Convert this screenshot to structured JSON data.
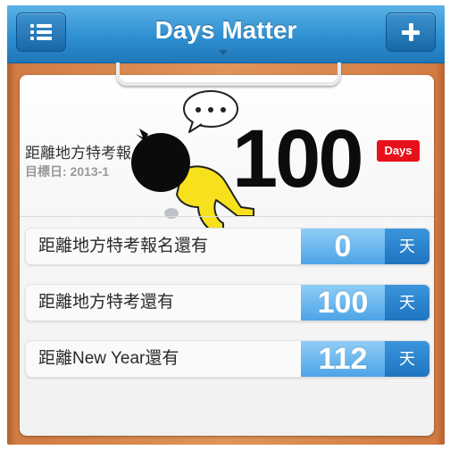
{
  "navbar": {
    "title": "Days Matter",
    "left_icon": "list-icon",
    "right_icon": "plus-icon"
  },
  "featured": {
    "headline": "距離地方特考報",
    "target_date": "目標日: 2013-1",
    "count": "100",
    "badge": "Days"
  },
  "events": [
    {
      "label": "距離地方特考報名還有",
      "days": "0",
      "unit": "天"
    },
    {
      "label": "距離地方特考還有",
      "days": "100",
      "unit": "天"
    },
    {
      "label": "距離New Year還有",
      "days": "112",
      "unit": "天"
    }
  ],
  "colors": {
    "nav_blue": "#2f8fd1",
    "badge_red": "#e8101b",
    "number_blue": "#4da4e6",
    "unit_blue": "#1f74c0",
    "mascot_yellow": "#f7e11c"
  }
}
